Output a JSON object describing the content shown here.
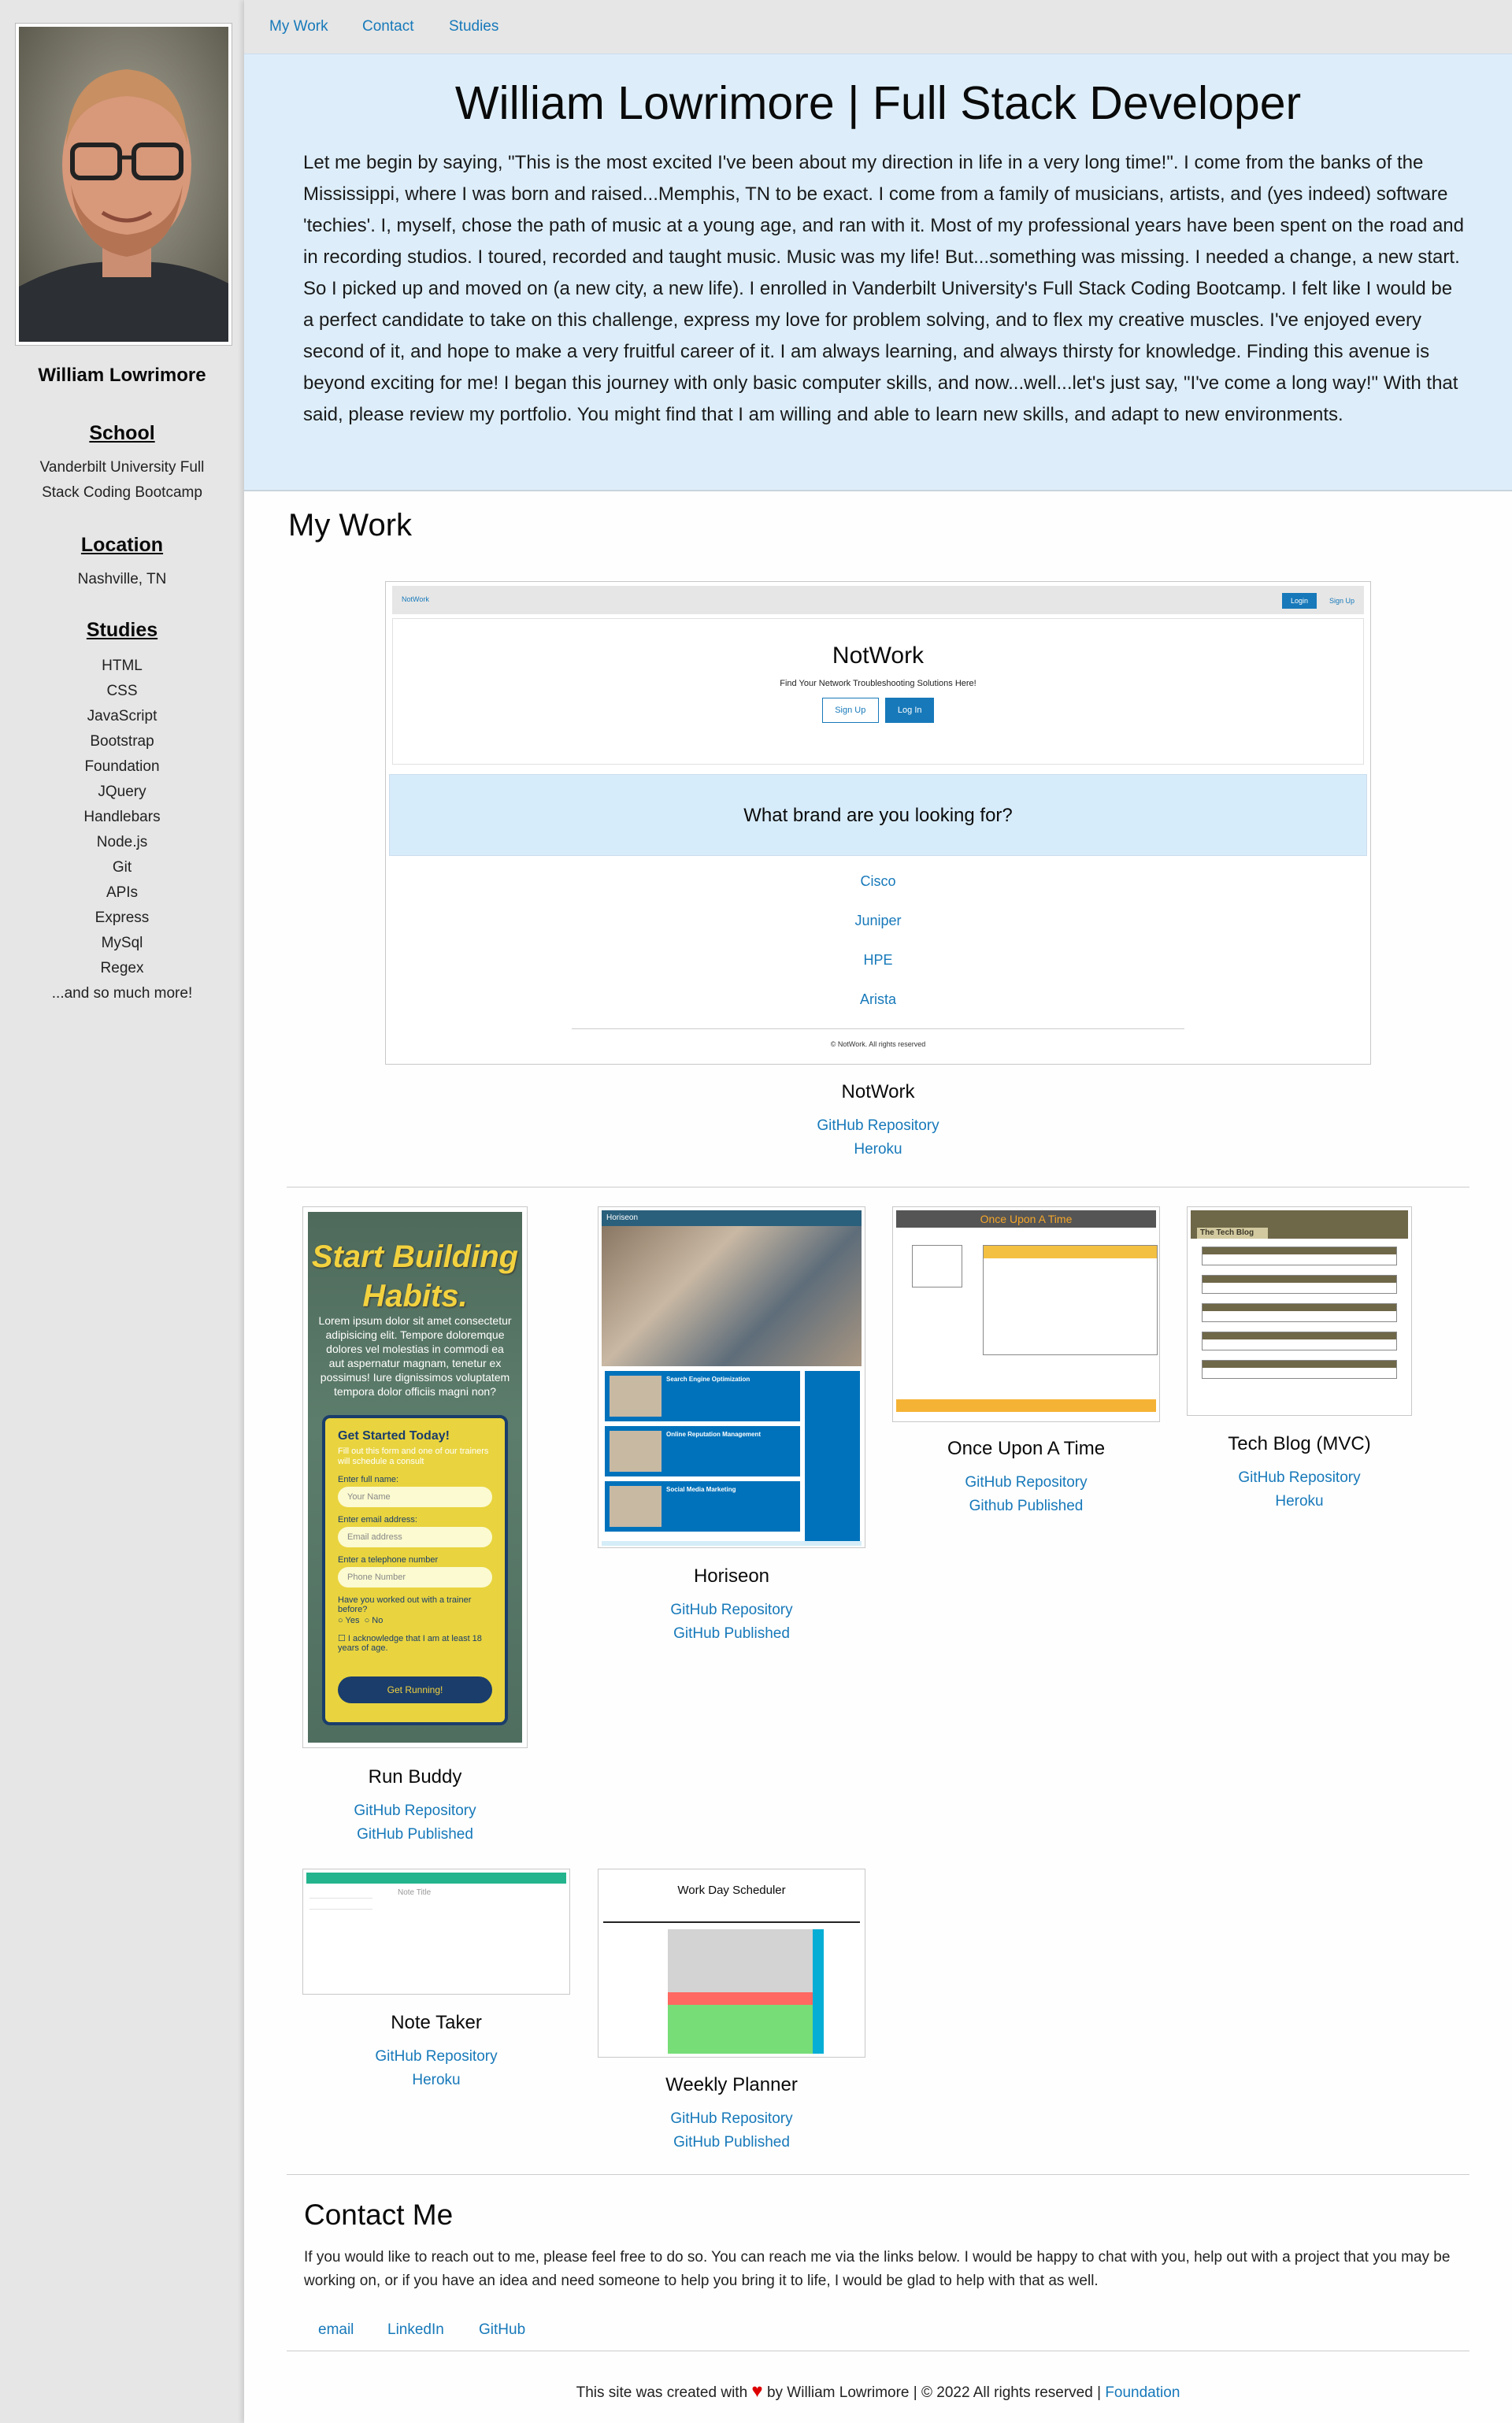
{
  "sidebar": {
    "name": "William Lowrimore",
    "school_heading": "School",
    "school": "Vanderbilt University Full Stack Coding Bootcamp",
    "location_heading": "Location",
    "location": "Nashville, TN",
    "studies_heading": "Studies",
    "studies": [
      "HTML",
      "CSS",
      "JavaScript",
      "Bootstrap",
      "Foundation",
      "JQuery",
      "Handlebars",
      "Node.js",
      "Git",
      "APIs",
      "Express",
      "MySql",
      "Regex",
      "...and so much more!"
    ]
  },
  "nav": {
    "items": [
      "My Work",
      "Contact",
      "Studies"
    ]
  },
  "hero": {
    "title": "William Lowrimore | Full Stack Developer",
    "bio": "Let me begin by saying, \"This is the most excited I've been about my direction in life in a very long time!\". I come from the banks of the Mississippi, where I was born and raised...Memphis, TN to be exact. I come from a family of musicians, artists, and (yes indeed) software 'techies'. I, myself, chose the path of music at a young age, and ran with it. Most of my professional years have been spent on the road and in recording studios. I toured, recorded and taught music. Music was my life! But...something was missing. I needed a change, a new start. So I picked up and moved on (a new city, a new life). I enrolled in Vanderbilt University's Full Stack Coding Bootcamp. I felt like I would be a perfect candidate to take on this challenge, express my love for problem solving, and to flex my creative muscles. I've enjoyed every second of it, and hope to make a very fruitful career of it. I am always learning, and always thirsty for knowledge. Finding this avenue is beyond exciting for me! I began this journey with only basic computer skills, and now...well...let's just say, \"I've come a long way!\" With that said, please review my portfolio. You might find that I am willing and able to learn new skills, and adapt to new environments."
  },
  "work": {
    "heading": "My Work",
    "featured": {
      "title": "NotWork",
      "links": [
        "GitHub Repository",
        "Heroku"
      ],
      "preview": {
        "brand": "NotWork",
        "login": "Login",
        "signup": "Sign Up",
        "hero_title": "NotWork",
        "hero_sub": "Find Your Network Troubleshooting Solutions Here!",
        "btn_signup": "Sign Up",
        "btn_login": "Log In",
        "question": "What brand are you looking for?",
        "brands": [
          "Cisco",
          "Juniper",
          "HPE",
          "Arista"
        ],
        "footer": "© NotWork. All rights reserved"
      }
    },
    "projects": [
      {
        "title": "Run Buddy",
        "links": [
          "GitHub Repository",
          "GitHub Published"
        ]
      },
      {
        "title": "Horiseon",
        "links": [
          "GitHub Repository",
          "GitHub Published"
        ]
      },
      {
        "title": "Once Upon A Time",
        "links": [
          "GitHub Repository",
          "Github Published"
        ]
      },
      {
        "title": "Tech Blog (MVC)",
        "links": [
          "GitHub Repository",
          "Heroku"
        ]
      },
      {
        "title": "Note Taker",
        "links": [
          "GitHub Repository",
          "Heroku"
        ]
      },
      {
        "title": "Weekly Planner",
        "links": [
          "GitHub Repository",
          "GitHub Published"
        ]
      }
    ],
    "runbuddy_preview": {
      "headline": "Start Building Habits.",
      "blurb": "Lorem ipsum dolor sit amet consectetur adipisicing elit. Tempore doloremque dolores vel molestias in commodi ea aut aspernatur magnam, tenetur ex possimus! Iure dignissimos voluptatem tempora dolor officiis magni non?",
      "form_title": "Get Started Today!",
      "form_desc": "Fill out this form and one of our trainers will schedule a consult",
      "label_name": "Enter full name:",
      "ph_name": "Your Name",
      "label_email": "Enter email address:",
      "ph_email": "Email address",
      "label_phone": "Enter a telephone number",
      "ph_phone": "Phone Number",
      "question": "Have you worked out with a trainer before?",
      "yes": "Yes",
      "no": "No",
      "ack": "I acknowledge that I am at least 18 years of age.",
      "button": "Get Running!"
    },
    "horiseon_preview": {
      "brand": "Horiseon",
      "blocks": [
        "Search Engine Optimization",
        "Online Reputation Management",
        "Social Media Marketing"
      ]
    },
    "onceupon_preview": {
      "title": "Once Upon A Time"
    },
    "techblog_preview": {
      "title": "The Tech Blog"
    },
    "notetaker_preview": {
      "title": "Note Title"
    },
    "planner_preview": {
      "title": "Work Day Scheduler"
    }
  },
  "contact": {
    "heading": "Contact Me",
    "text": "If you would like to reach out to me, please feel free to do so. You can reach me via the links below. I would be happy to chat with you, help out with a project that you may be working on, or if you have an idea and need someone to help you bring it to life, I would be glad to help with that as well.",
    "links": [
      "email",
      "LinkedIn",
      "GitHub"
    ]
  },
  "footer": {
    "prefix": "This site was created with",
    "heart": "♥",
    "suffix": "by William Lowrimore | © 2022 All rights reserved |",
    "link": "Foundation"
  }
}
